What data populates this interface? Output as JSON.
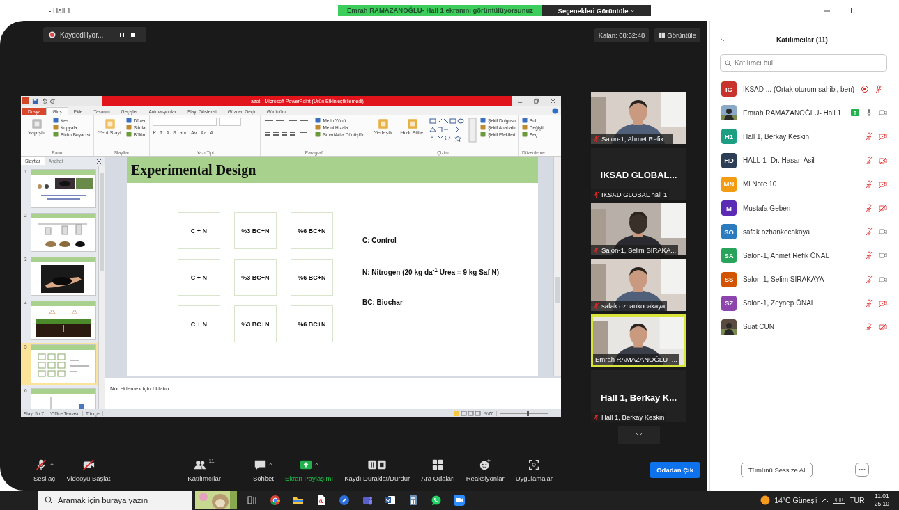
{
  "window": {
    "title": "- Hall 1"
  },
  "share_banner": {
    "text": "Emrah RAMAZANOĞLU- Hall 1 ekranını görüntülüyorsunuz",
    "options_button": "Seçenekleri Görüntüle"
  },
  "recording": {
    "label": "Kaydediliyor..."
  },
  "timer": "Kalan: 08:52:48",
  "view_button": "Görüntüle",
  "presentation": {
    "title": "azot - Microsoft PowerPoint (Ürün Etkinleştirilemedi)",
    "tabs": [
      {
        "label": "Dosya",
        "kind": "file",
        "selected": false
      },
      {
        "label": "Giriş",
        "kind": "tab",
        "selected": true
      },
      {
        "label": "Ekle",
        "kind": "tab",
        "selected": false
      },
      {
        "label": "Tasarım",
        "kind": "tab",
        "selected": false
      },
      {
        "label": "Geçişler",
        "kind": "tab",
        "selected": false
      },
      {
        "label": "Animasyonlar",
        "kind": "tab",
        "selected": false
      },
      {
        "label": "Slayt Gösterisi",
        "kind": "tab",
        "selected": false
      },
      {
        "label": "Gözden Geçir",
        "kind": "tab",
        "selected": false
      },
      {
        "label": "Görünüm",
        "kind": "tab",
        "selected": false
      }
    ],
    "ribbon": [
      {
        "label": "Pano",
        "kind": "clipboard",
        "large": [
          "Yapıştır"
        ],
        "buttons": [
          "Kes",
          "Kopyala",
          "Biçim Boyacısı"
        ]
      },
      {
        "label": "Slaytlar",
        "kind": "slides",
        "large": [
          "Yeni Slayt"
        ],
        "buttons": [
          "Düzen",
          "Sıfırla",
          "Bölüm"
        ]
      },
      {
        "label": "Yazı Tipi",
        "kind": "font",
        "buttons": [
          "K",
          "T",
          "A",
          "S",
          "abc",
          "AV",
          "Aa",
          "A"
        ]
      },
      {
        "label": "Paragraf",
        "kind": "paragraph",
        "buttons": [
          "Metin Yönü",
          "Metni Hizala",
          "SmartArt'a Dönüştür"
        ]
      },
      {
        "label": "Çizim",
        "kind": "drawing",
        "large": [
          "Yerleştir",
          "Hızlı Stiller"
        ],
        "buttons": [
          "Şekil Dolgusu",
          "Şekil Anahattı",
          "Şekil Efektleri"
        ]
      },
      {
        "label": "Düzenleme",
        "kind": "editing",
        "buttons": [
          "Bul",
          "Değiştir",
          "Seç"
        ]
      }
    ],
    "pane_tabs": [
      {
        "label": "Slaytlar",
        "selected": true
      },
      {
        "label": "Anahat",
        "selected": false
      }
    ],
    "thumbnails": [
      {
        "number": "1",
        "selected": false
      },
      {
        "number": "2",
        "selected": false
      },
      {
        "number": "3",
        "selected": false
      },
      {
        "number": "4",
        "selected": false
      },
      {
        "number": "5",
        "selected": true
      },
      {
        "number": "6",
        "selected": false
      }
    ],
    "slide": {
      "title": "Experimental Design",
      "grid": [
        [
          "C + N",
          "%3 BC+N",
          "%6 BC+N"
        ],
        [
          "C + N",
          "%3 BC+N",
          "%6 BC+N"
        ],
        [
          "C + N",
          "%3 BC+N",
          "%6 BC+N"
        ]
      ],
      "legend": [
        "C: Control",
        "N: Nitrogen  (20 kg da$^{-1}$ Urea = 9 kg Saf N)",
        "BC: Biochar"
      ]
    },
    "notes_placeholder": "Not eklemek için tıklatın",
    "status_bar": {
      "slide": "Slayt 5 / 7",
      "theme": "'Office Teması'",
      "language": "Türkçe",
      "zoom": "%76",
      "zoom_slider": {
        "level": 0.55
      }
    }
  },
  "video_tiles": [
    {
      "kind": "video",
      "name": "Salon-1, Ahmet Refik ...",
      "muted": true,
      "speaking": false
    },
    {
      "kind": "name",
      "display": "IKSAD GLOBAL...",
      "name": "IKSAD GLOBAL hall 1",
      "muted": true,
      "speaking": false
    },
    {
      "kind": "video",
      "name": "Salon-1, Selim SIRAKA...",
      "muted": true,
      "speaking": false
    },
    {
      "kind": "video",
      "name": "safak ozhankocakaya",
      "muted": true,
      "speaking": false
    },
    {
      "kind": "video",
      "name": "Emrah RAMAZANOĞLU- ...",
      "muted": false,
      "speaking": true
    },
    {
      "kind": "name",
      "display": "Hall 1, Berkay K...",
      "name": "Hall 1, Berkay Keskin",
      "muted": true,
      "speaking": false
    }
  ],
  "toolbar": [
    {
      "kind": "mic",
      "label": "Sesi aç",
      "muted": true,
      "caret": true,
      "active": false
    },
    {
      "kind": "video",
      "label": "Videoyu Başlat",
      "muted": true,
      "caret": false,
      "active": false
    },
    {
      "kind": "participants",
      "label": "Katılımcılar",
      "count": "11",
      "caret": false,
      "active": false
    },
    {
      "kind": "chat",
      "label": "Sohbet",
      "caret": true,
      "active": false
    },
    {
      "kind": "share",
      "label": "Ekran Paylaşımı",
      "caret": true,
      "active": true
    },
    {
      "kind": "record",
      "label": "Kaydı Duraklat/Durdur",
      "caret": false,
      "active": false
    },
    {
      "kind": "rooms",
      "label": "Ara Odaları",
      "caret": false,
      "active": false
    },
    {
      "kind": "reactions",
      "label": "Reaksiyonlar",
      "caret": false,
      "active": false
    },
    {
      "kind": "apps",
      "label": "Uygulamalar",
      "caret": false,
      "active": false
    }
  ],
  "leave_button": "Odadan Çık",
  "participants_panel": {
    "title": "Katılımcılar (11)",
    "search": {
      "placeholder": "Katılımcı bul"
    },
    "items": [
      {
        "kind": "initials",
        "initials": "IG",
        "color": "#c8342c",
        "name": "IKSAD ...  (Ortak oturum sahibi, ben)",
        "recording": true,
        "sharing": false,
        "muted": true
      },
      {
        "name": "Emrah RAMAZANOĞLU- Hall 1",
        "recording": false,
        "sharing": true,
        "muted": false,
        "video": true
      },
      {
        "kind": "initials",
        "initials": "H1",
        "color": "#1b9e82",
        "name": "Hall 1, Berkay Keskin",
        "recording": false,
        "sharing": false,
        "muted": true,
        "video": false
      },
      {
        "kind": "initials",
        "initials": "HD",
        "color": "#2c3e55",
        "name": "HALL-1- Dr. Hasan Asil",
        "recording": false,
        "sharing": false,
        "muted": true,
        "video": false
      },
      {
        "kind": "initials",
        "initials": "MN",
        "color": "#f39c12",
        "name": "Mi Note 10",
        "recording": false,
        "sharing": false,
        "muted": true,
        "video": false
      },
      {
        "kind": "initials",
        "initials": "M",
        "color": "#5b2bb5",
        "name": "Mustafa Geben",
        "recording": false,
        "sharing": false,
        "muted": true,
        "video": false
      },
      {
        "kind": "initials",
        "initials": "SO",
        "color": "#2b7bbf",
        "name": "safak ozhankocakaya",
        "recording": false,
        "sharing": false,
        "muted": true,
        "video": true
      },
      {
        "kind": "initials",
        "initials": "SA",
        "color": "#27a45a",
        "name": "Salon-1, Ahmet Refik ÖNAL",
        "recording": false,
        "sharing": false,
        "muted": true,
        "video": true
      },
      {
        "kind": "initials",
        "initials": "SS",
        "color": "#d35400",
        "name": "Salon-1, Selim SIRAKAYA",
        "recording": false,
        "sharing": false,
        "muted": true,
        "video": true
      },
      {
        "kind": "initials",
        "initials": "SZ",
        "color": "#8e44ad",
        "name": "Salon-1, Zeynep ÖNAL",
        "recording": false,
        "sharing": false,
        "muted": true,
        "video": false
      },
      {
        "name": "Suat CUN",
        "recording": false,
        "sharing": false,
        "muted": true,
        "video": false
      }
    ],
    "mute_all_button": "Tümünü Sessize Al"
  },
  "taskbar": {
    "search_placeholder": "Aramak için buraya yazın",
    "weather": "14°C Güneşli",
    "language": "TUR",
    "time": "11:01",
    "date": "25.10"
  }
}
